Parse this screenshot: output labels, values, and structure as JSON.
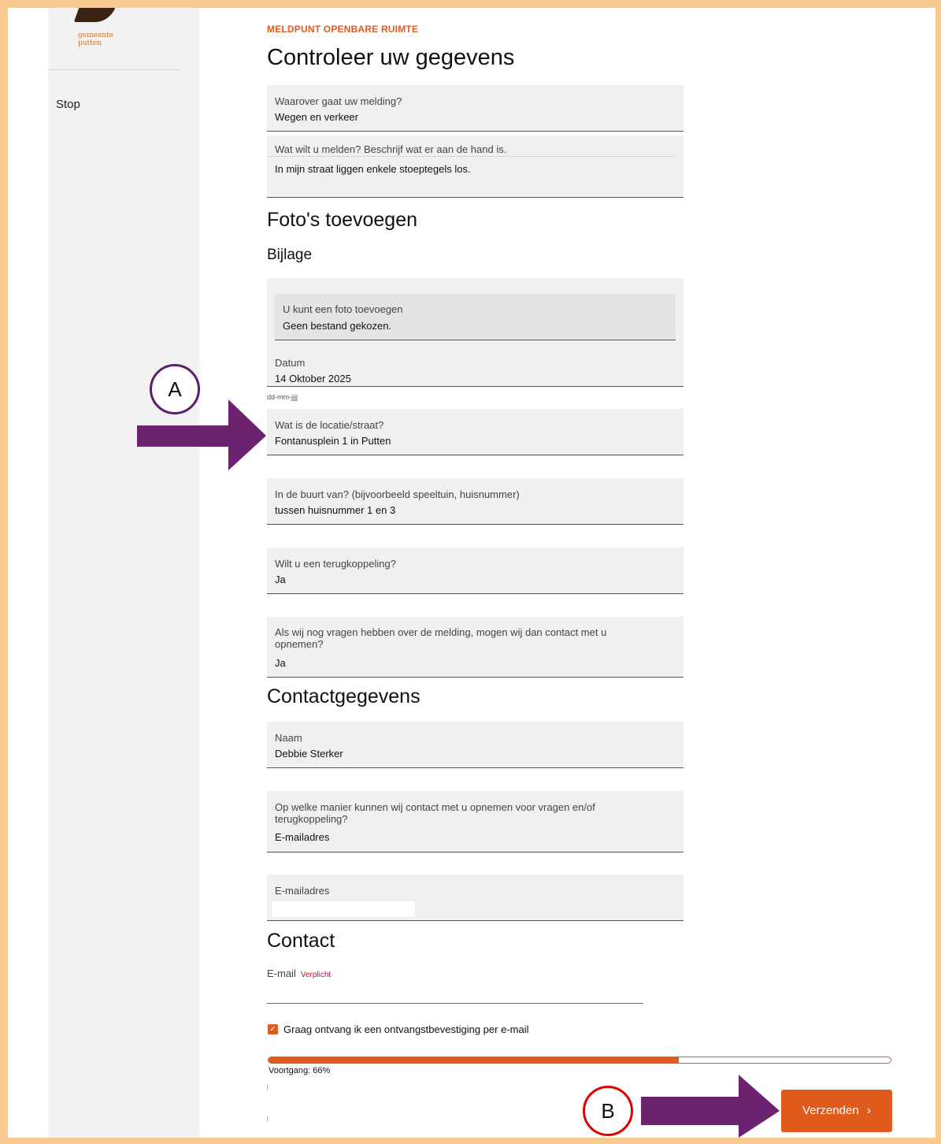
{
  "sidebar": {
    "logo_line1": "gemeente",
    "logo_line2": "putten",
    "stop_label": "Stop"
  },
  "header": {
    "breadcrumb": "MELDPUNT OPENBARE RUIMTE",
    "title": "Controleer uw gegevens"
  },
  "fields": {
    "topic": {
      "label": "Waarover gaat uw melding?",
      "value": "Wegen en verkeer"
    },
    "description": {
      "label": "Wat wilt u melden? Beschrijf wat er aan de hand is.",
      "value": "In mijn straat liggen enkele stoeptegels los."
    }
  },
  "photos": {
    "heading": "Foto's toevoegen",
    "subheading": "Bijlage",
    "upload_label": "U kunt een foto toevoegen",
    "upload_value": "Geen bestand gekozen.",
    "date_label": "Datum",
    "date_value": "14 Oktober 2025",
    "date_hint": "dd-mm-jjjj"
  },
  "location": {
    "street_label": "Wat is de locatie/straat?",
    "street_value": "Fontanusplein 1 in Putten",
    "near_label": "In de buurt van? (bijvoorbeeld speeltuin, huisnummer)",
    "near_value": "tussen huisnummer 1 en 3",
    "feedback_label": "Wilt u een terugkoppeling?",
    "feedback_value": "Ja",
    "contact_ok_label": "Als wij nog vragen hebben over de melding, mogen wij dan contact met u opnemen?",
    "contact_ok_value": "Ja"
  },
  "contact_details": {
    "heading": "Contactgegevens",
    "name_label": "Naam",
    "name_value": "Debbie Sterker",
    "method_label": "Op welke manier kunnen wij contact met u opnemen voor vragen en/of terugkoppeling?",
    "method_value": "E-mailadres",
    "email_label": "E-mailadres",
    "email_value": ""
  },
  "contact": {
    "heading": "Contact",
    "email_label": "E-mail",
    "required_label": "Verplicht",
    "confirmation_checkbox_label": "Graag ontvang ik een ontvangstbevestiging per e-mail",
    "confirmation_checked": true
  },
  "progress": {
    "text": "Voortgang: 66%",
    "fraction": 0.66
  },
  "submit": {
    "label": "Verzenden",
    "chevron": "›"
  },
  "annotations": {
    "a_label": "A",
    "b_label": "B",
    "arrow_color": "#6b2370",
    "circle_a_color": "#5a1e6b",
    "circle_b_color": "#e00000"
  },
  "colors": {
    "accent": "#e05a1c",
    "outer_frame": "#f7c98e"
  }
}
